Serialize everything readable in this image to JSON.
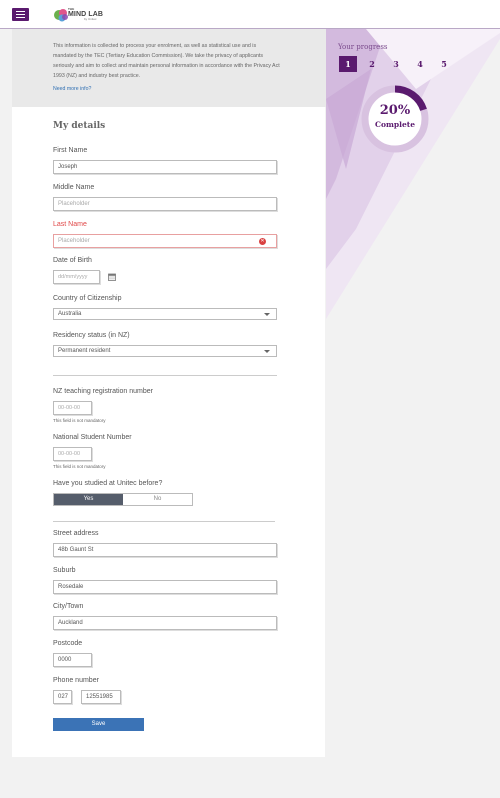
{
  "header": {
    "logo_line1": "THE",
    "logo_line2": "MIND LAB",
    "logo_sub": "by Unitec"
  },
  "progress": {
    "title": "Your progress",
    "steps": [
      "1",
      "2",
      "3",
      "4",
      "5"
    ],
    "active_step": 1,
    "percent_value": 0.2,
    "percent_text": "20%",
    "complete_label": "Complete"
  },
  "info": {
    "text": "This information is collected to process your enrolment, as well as statistical use and is mandated by the TEC (Tertiary Education Commission). We take the privacy of applicants seriously and aim to collect and maintain personal information in accordance with the Privacy Act 1993 (NZ) and industry best practice.",
    "link": "Need more info?"
  },
  "form": {
    "heading": "My details",
    "first_name": {
      "label": "First Name",
      "value": "Joseph"
    },
    "middle_name": {
      "label": "Middle Name",
      "placeholder": "Placeholder"
    },
    "last_name": {
      "label": "Last Name",
      "placeholder": "Placeholder"
    },
    "dob": {
      "label": "Date of Birth",
      "placeholder": "dd/mm/yyyy"
    },
    "citizenship": {
      "label": "Country of Citizenship",
      "value": "Australia"
    },
    "residency": {
      "label": "Residency status (in NZ)",
      "value": "Permanent resident"
    },
    "teaching_reg": {
      "label": "NZ teaching registration number",
      "placeholder": "00-00-00",
      "hint": "This field is not mandatory"
    },
    "nsn": {
      "label": "National Student Number",
      "placeholder": "00-00-00",
      "hint": "This field is not mandatory"
    },
    "studied_before": {
      "label": "Have you studied at Unitec before?",
      "yes": "Yes",
      "no": "No"
    },
    "street": {
      "label": "Street address",
      "value": "48b Gaunt St"
    },
    "suburb": {
      "label": "Suburb",
      "value": "Rosedale"
    },
    "city": {
      "label": "City/Town",
      "value": "Auckland"
    },
    "postcode": {
      "label": "Postcode",
      "value": "0000"
    },
    "phone": {
      "label": "Phone number",
      "area": "027",
      "number": "12551985"
    },
    "save": "Save"
  },
  "colors": {
    "brand_purple": "#5a1a6e",
    "accent_blue": "#3b73b6",
    "error_red": "#e04848"
  }
}
